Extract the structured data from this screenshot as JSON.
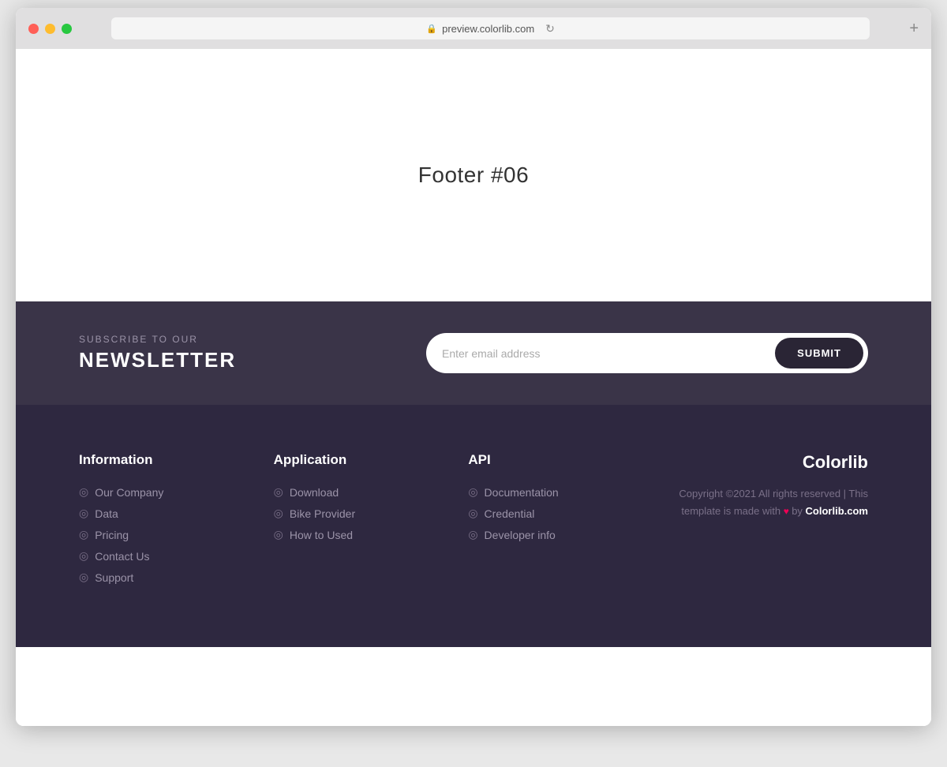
{
  "browser": {
    "url": "preview.colorlib.com",
    "new_tab_label": "+"
  },
  "hero": {
    "title": "Footer #06"
  },
  "newsletter": {
    "subscribe_label": "SUBSCRIBE TO OUR",
    "heading": "NEWSLETTER",
    "input_placeholder": "Enter email address",
    "submit_label": "SUBMIT"
  },
  "footer": {
    "information": {
      "title": "Information",
      "links": [
        "Our Company",
        "Data",
        "Pricing",
        "Contact Us",
        "Support"
      ]
    },
    "application": {
      "title": "Application",
      "links": [
        "Download",
        "Bike Provider",
        "How to Used"
      ]
    },
    "api": {
      "title": "API",
      "links": [
        "Documentation",
        "Credential",
        "Developer info"
      ]
    },
    "brand": {
      "name": "Colorlib",
      "copyright": "Copyright ©2021 All rights reserved | This template is made with",
      "made_by": "Colorlib.com"
    }
  }
}
